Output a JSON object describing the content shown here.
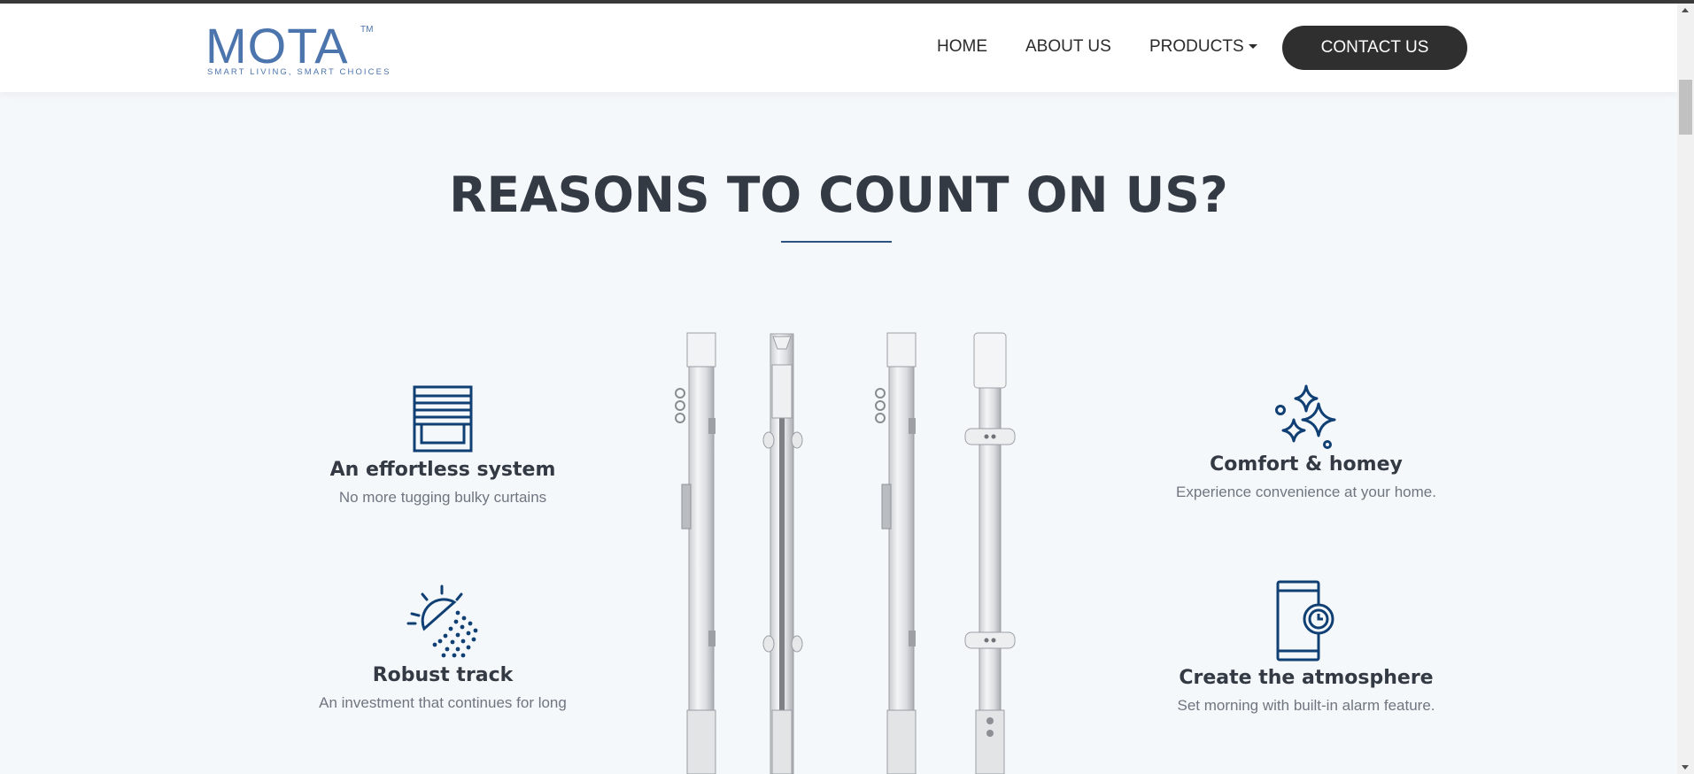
{
  "header": {
    "logo": {
      "wordmark": "MOTA",
      "trademark": "TM",
      "tagline": "SMART LIVING, SMART CHOICES"
    },
    "nav": {
      "home": "HOME",
      "about": "ABOUT US",
      "products": "PRODUCTS",
      "contact": "CONTACT US"
    }
  },
  "section": {
    "title": "REASONS TO COUNT ON US?",
    "accent_color": "#2c5282",
    "features": [
      {
        "title": "An effortless system",
        "description": "No more tugging bulky curtains",
        "icon": "blinds-icon"
      },
      {
        "title": "Robust track",
        "description": "An investment that continues for long",
        "icon": "sun-icon"
      },
      {
        "title": "Comfort & homey",
        "description": "Experience convenience at your home.",
        "icon": "sparkles-icon"
      },
      {
        "title": "Create the atmosphere",
        "description": "Set morning with built-in alarm feature.",
        "icon": "phone-alarm-icon"
      }
    ]
  },
  "colors": {
    "brand_blue": "#4c75ad",
    "icon_navy": "#0f3f73",
    "button_dark": "#2f2f2f",
    "heading": "#343a44"
  }
}
